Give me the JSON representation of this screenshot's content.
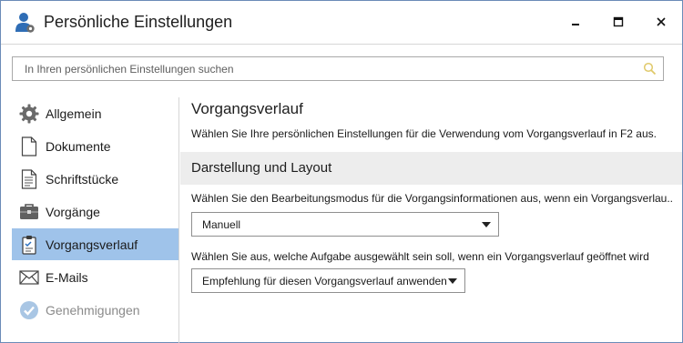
{
  "window": {
    "title": "Persönliche Einstellungen",
    "controls": [
      "minimize-icon",
      "maximize-icon",
      "close-icon"
    ]
  },
  "search": {
    "placeholder": "In Ihren persönlichen Einstellungen suchen",
    "value": ""
  },
  "sidebar": {
    "items": [
      {
        "label": "Allgemein",
        "icon": "gear-icon",
        "active": false,
        "disabled": false
      },
      {
        "label": "Dokumente",
        "icon": "document-icon",
        "active": false,
        "disabled": false
      },
      {
        "label": "Schriftstücke",
        "icon": "text-document-icon",
        "active": false,
        "disabled": false
      },
      {
        "label": "Vorgänge",
        "icon": "briefcase-icon",
        "active": false,
        "disabled": false
      },
      {
        "label": "Vorgangsverlauf",
        "icon": "clipboard-icon",
        "active": true,
        "disabled": false
      },
      {
        "label": "E-Mails",
        "icon": "envelope-icon",
        "active": false,
        "disabled": false
      },
      {
        "label": "Genehmigungen",
        "icon": "check-circle-icon",
        "active": false,
        "disabled": true
      }
    ]
  },
  "main": {
    "title": "Vorgangsverlauf",
    "description": "Wählen Sie Ihre persönlichen Einstellungen für die Verwendung vom Vorgangsverlauf in F2 aus.",
    "section": {
      "title": "Darstellung und Layout",
      "fields": [
        {
          "label": "Wählen Sie den Bearbeitungsmodus für die Vorgangsinformationen aus, wenn ein Vorgangsverlau...",
          "selected": "Manuell"
        },
        {
          "label": "Wählen Sie aus, welche Aufgabe ausgewählt sein soll, wenn ein Vorgangsverlauf geöffnet wird",
          "selected": "Empfehlung für diesen Vorgangsverlauf anwenden"
        }
      ]
    }
  },
  "colors": {
    "active_item_bg": "#9fc3ea",
    "section_bg": "#ededed",
    "border": "#d6d6d6",
    "window_border": "#6b8bb8"
  }
}
